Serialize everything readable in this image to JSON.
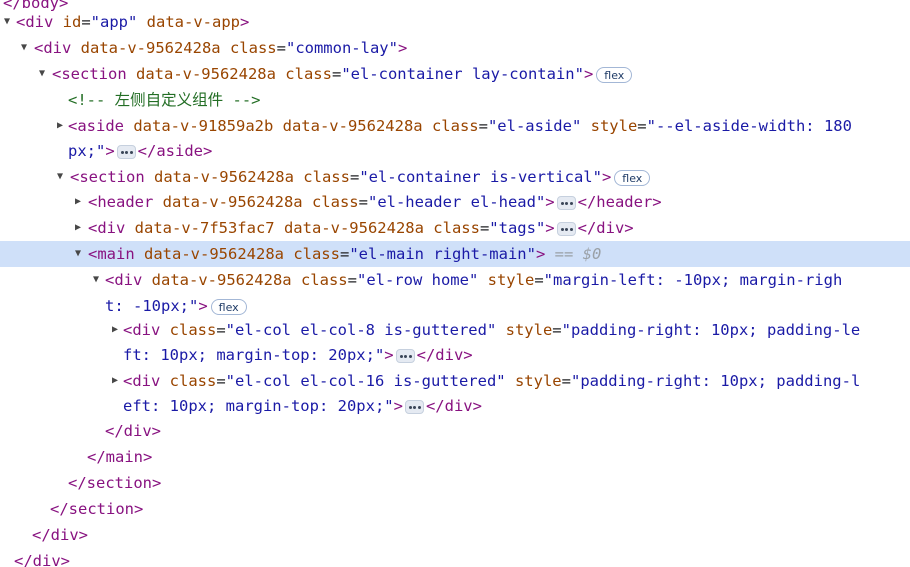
{
  "panel": {
    "lines": [
      {
        "segs": [
          [
            "tag",
            "</body>"
          ]
        ]
      },
      {
        "segs": [
          [
            "tag",
            "<div"
          ],
          [
            "attr",
            " id"
          ],
          [
            "eq",
            "="
          ],
          [
            "val",
            "\"app\""
          ],
          [
            "attr",
            " data-v-app"
          ],
          [
            "tag",
            ">"
          ]
        ]
      },
      {
        "segs": [
          [
            "tag",
            "<div"
          ],
          [
            "attr",
            " data-v-9562428a"
          ],
          [
            "attr",
            " class"
          ],
          [
            "eq",
            "="
          ],
          [
            "val",
            "\"common-lay\""
          ],
          [
            "tag",
            ">"
          ]
        ]
      },
      {
        "segs": [
          [
            "tag",
            "<section"
          ],
          [
            "attr",
            " data-v-9562428a"
          ],
          [
            "attr",
            " class"
          ],
          [
            "eq",
            "="
          ],
          [
            "val",
            "\"el-container lay-contain\""
          ],
          [
            "tag",
            ">"
          ]
        ],
        "badge": "flex"
      },
      {
        "segs": [
          [
            "cmt",
            "<!-- 左侧自定义组件 -->"
          ]
        ]
      },
      {
        "segs": [
          [
            "tag",
            "<aside"
          ],
          [
            "attr",
            " data-v-91859a2b"
          ],
          [
            "attr",
            " data-v-9562428a"
          ],
          [
            "attr",
            " class"
          ],
          [
            "eq",
            "="
          ],
          [
            "val",
            "\"el-aside\""
          ],
          [
            "attr",
            " style"
          ],
          [
            "eq",
            "="
          ],
          [
            "val",
            "\"--el-aside-width: 180"
          ]
        ]
      },
      {
        "segs": [
          [
            "val",
            "px;\""
          ],
          [
            "tag",
            ">"
          ]
        ],
        "ellipsis": true,
        "after": [
          [
            "tag",
            "</aside>"
          ]
        ]
      },
      {
        "segs": [
          [
            "tag",
            "<section"
          ],
          [
            "attr",
            " data-v-9562428a"
          ],
          [
            "attr",
            " class"
          ],
          [
            "eq",
            "="
          ],
          [
            "val",
            "\"el-container is-vertical\""
          ],
          [
            "tag",
            ">"
          ]
        ],
        "badge": "flex"
      },
      {
        "segs": [
          [
            "tag",
            "<header"
          ],
          [
            "attr",
            " data-v-9562428a"
          ],
          [
            "attr",
            " class"
          ],
          [
            "eq",
            "="
          ],
          [
            "val",
            "\"el-header el-head\""
          ],
          [
            "tag",
            ">"
          ]
        ],
        "ellipsis": true,
        "after": [
          [
            "tag",
            "</header>"
          ]
        ]
      },
      {
        "segs": [
          [
            "tag",
            "<div"
          ],
          [
            "attr",
            " data-v-7f53fac7"
          ],
          [
            "attr",
            " data-v-9562428a"
          ],
          [
            "attr",
            " class"
          ],
          [
            "eq",
            "="
          ],
          [
            "val",
            "\"tags\""
          ],
          [
            "tag",
            ">"
          ]
        ],
        "ellipsis": true,
        "after": [
          [
            "tag",
            "</div>"
          ]
        ]
      },
      {
        "segs": [
          [
            "tag",
            "<main"
          ],
          [
            "attr",
            " data-v-9562428a"
          ],
          [
            "attr",
            " class"
          ],
          [
            "eq",
            "="
          ],
          [
            "val",
            "\"el-main right-main\""
          ],
          [
            "tag",
            ">"
          ]
        ],
        "dollar": " == $0"
      },
      {
        "segs": [
          [
            "tag",
            "<div"
          ],
          [
            "attr",
            " data-v-9562428a"
          ],
          [
            "attr",
            " class"
          ],
          [
            "eq",
            "="
          ],
          [
            "val",
            "\"el-row home\""
          ],
          [
            "attr",
            " style"
          ],
          [
            "eq",
            "="
          ],
          [
            "val",
            "\"margin-left: -10px; margin-righ"
          ]
        ]
      },
      {
        "segs": [
          [
            "val",
            "t: -10px;\""
          ],
          [
            "tag",
            ">"
          ]
        ],
        "badge": "flex"
      },
      {
        "segs": [
          [
            "tag",
            "<div"
          ],
          [
            "attr",
            " class"
          ],
          [
            "eq",
            "="
          ],
          [
            "val",
            "\"el-col el-col-8 is-guttered\""
          ],
          [
            "attr",
            " style"
          ],
          [
            "eq",
            "="
          ],
          [
            "val",
            "\"padding-right: 10px; padding-le"
          ]
        ]
      },
      {
        "segs": [
          [
            "val",
            "ft: 10px; margin-top: 20px;\""
          ],
          [
            "tag",
            ">"
          ]
        ],
        "ellipsis": true,
        "after": [
          [
            "tag",
            "</div>"
          ]
        ]
      },
      {
        "segs": [
          [
            "tag",
            "<div"
          ],
          [
            "attr",
            " class"
          ],
          [
            "eq",
            "="
          ],
          [
            "val",
            "\"el-col el-col-16 is-guttered\""
          ],
          [
            "attr",
            " style"
          ],
          [
            "eq",
            "="
          ],
          [
            "val",
            "\"padding-right: 10px; padding-l"
          ]
        ]
      },
      {
        "segs": [
          [
            "val",
            "eft: 10px; margin-top: 20px;\""
          ],
          [
            "tag",
            ">"
          ]
        ],
        "ellipsis": true,
        "after": [
          [
            "tag",
            "</div>"
          ]
        ]
      },
      {
        "segs": [
          [
            "tag",
            "</div>"
          ]
        ]
      },
      {
        "segs": [
          [
            "tag",
            "</main>"
          ]
        ]
      },
      {
        "segs": [
          [
            "tag",
            "</section>"
          ]
        ]
      },
      {
        "segs": [
          [
            "tag",
            "</section>"
          ]
        ]
      },
      {
        "segs": [
          [
            "tag",
            "</div>"
          ]
        ]
      },
      {
        "segs": [
          [
            "tag",
            "</div>"
          ]
        ]
      }
    ]
  }
}
